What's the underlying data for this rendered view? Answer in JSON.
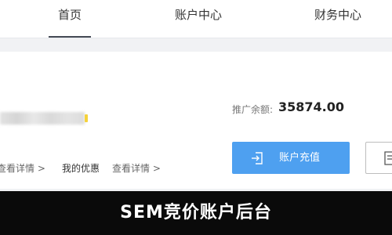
{
  "nav": {
    "tabs": [
      {
        "label": "首页"
      },
      {
        "label": "账户中心"
      },
      {
        "label": "财务中心"
      }
    ]
  },
  "account": {
    "detail_link_1": "查看详情 >",
    "benefit_label": "我的优惠",
    "detail_link_2": "查看详情 >"
  },
  "balance": {
    "label": "推广余额:",
    "value": "35874.00"
  },
  "actions": {
    "recharge_label": "账户充值"
  },
  "banner": {
    "text": "SEM竞价账户后台"
  },
  "colors": {
    "accent": "#4ea0f0",
    "name_tag": "#f5d23c",
    "banner_bg": "#0a0a0a"
  },
  "icons": {
    "recharge": "login-arrow-icon",
    "outline": "document-icon"
  }
}
